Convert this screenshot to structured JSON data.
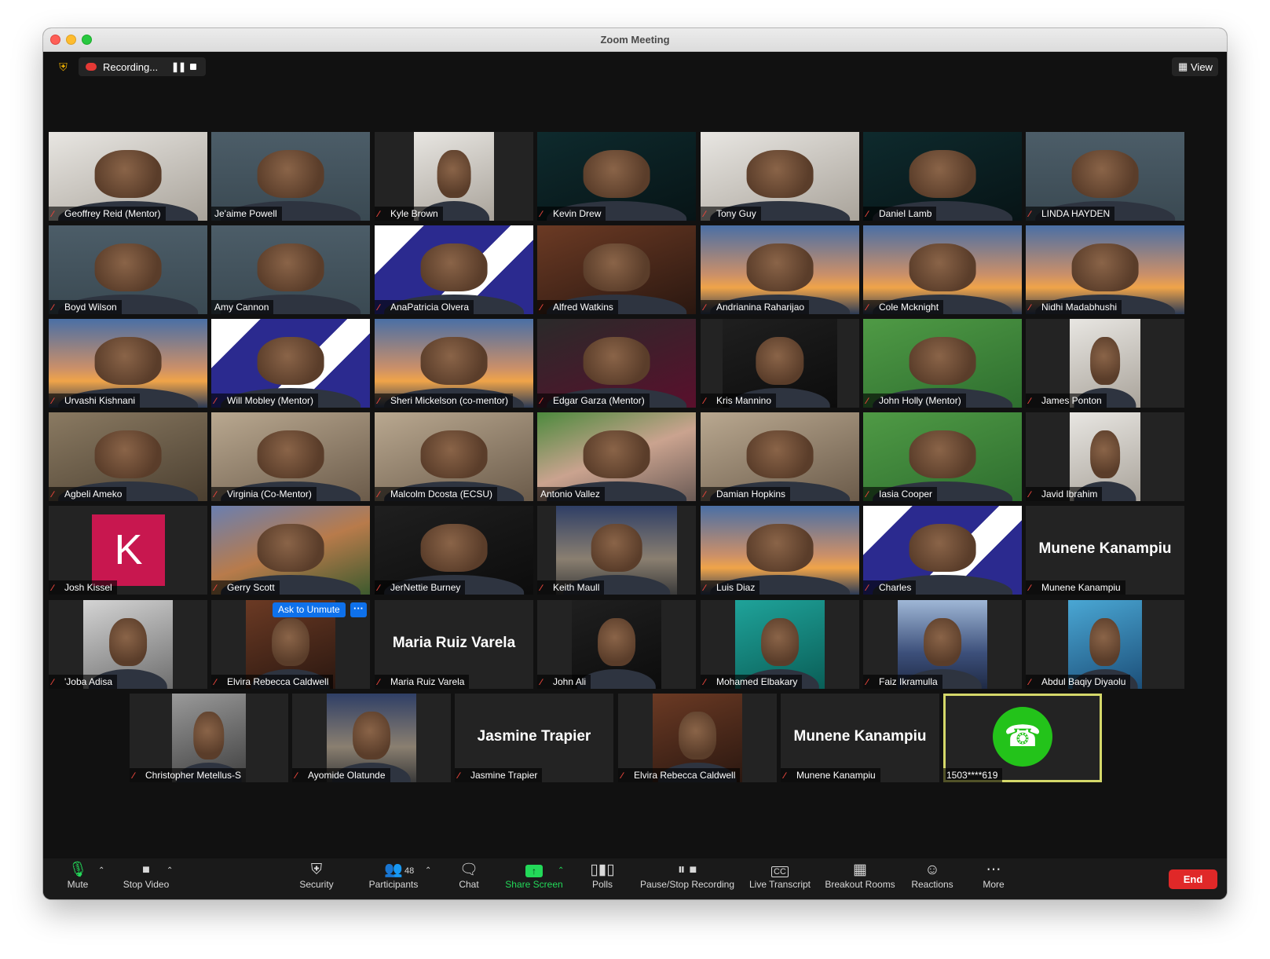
{
  "window": {
    "title": "Zoom Meeting"
  },
  "topbar": {
    "recording_label": "Recording...",
    "view_label": "View"
  },
  "participants": [
    {
      "name": "Geoffrey Reid (Mentor)",
      "muted": true
    },
    {
      "name": "Je'aime Powell",
      "muted": false
    },
    {
      "name": "Kyle Brown",
      "muted": true
    },
    {
      "name": "Kevin Drew",
      "muted": true
    },
    {
      "name": "Tony Guy",
      "muted": true
    },
    {
      "name": "Daniel Lamb",
      "muted": true
    },
    {
      "name": "LINDA HAYDEN",
      "muted": true
    },
    {
      "name": "Boyd Wilson",
      "muted": true
    },
    {
      "name": "Amy Cannon",
      "muted": false
    },
    {
      "name": "AnaPatricia Olvera",
      "muted": true
    },
    {
      "name": "Alfred Watkins",
      "muted": true
    },
    {
      "name": "Andrianina Raharijao",
      "muted": true
    },
    {
      "name": "Cole Mcknight",
      "muted": true
    },
    {
      "name": "Nidhi Madabhushi",
      "muted": true
    },
    {
      "name": "Urvashi Kishnani",
      "muted": true
    },
    {
      "name": "Will Mobley (Mentor)",
      "muted": true
    },
    {
      "name": "Sheri Mickelson (co-mentor)",
      "muted": true
    },
    {
      "name": "Edgar Garza (Mentor)",
      "muted": true
    },
    {
      "name": "Kris Mannino",
      "muted": true
    },
    {
      "name": "John Holly (Mentor)",
      "muted": true
    },
    {
      "name": "James Ponton",
      "muted": true
    },
    {
      "name": "Agbeli Ameko",
      "muted": true
    },
    {
      "name": "Virginia (Co-Mentor)",
      "muted": true
    },
    {
      "name": "Malcolm Dcosta (ECSU)",
      "muted": true
    },
    {
      "name": "Antonio Vallez",
      "muted": false
    },
    {
      "name": "Damian Hopkins",
      "muted": true
    },
    {
      "name": "Iasia Cooper",
      "muted": true
    },
    {
      "name": "Javid Ibrahim",
      "muted": true
    },
    {
      "name": "Josh Kissel",
      "muted": true,
      "avatar_letter": "K"
    },
    {
      "name": "Gerry Scott",
      "muted": true
    },
    {
      "name": "JerNettie Burney",
      "muted": true
    },
    {
      "name": "Keith Maull",
      "muted": true
    },
    {
      "name": "Luis Diaz",
      "muted": true
    },
    {
      "name": "Charles",
      "muted": true
    },
    {
      "name": "Munene Kanampiu",
      "muted": true,
      "display_name": "Munene Kanampiu"
    },
    {
      "name": "'Joba Adisa",
      "muted": true
    },
    {
      "name": "Elvira Rebecca Caldwell",
      "muted": true,
      "ask_to_unmute": "Ask to Unmute",
      "more": "···"
    },
    {
      "name": "Maria Ruiz Varela",
      "muted": true,
      "display_name": "Maria Ruiz Varela"
    },
    {
      "name": "John Ali",
      "muted": true
    },
    {
      "name": "Mohamed Elbakary",
      "muted": true
    },
    {
      "name": "Faiz Ikramulla",
      "muted": true
    },
    {
      "name": "Abdul Baqiy Diyaolu",
      "muted": true
    },
    {
      "name": "Christopher Metellus-S",
      "muted": true
    },
    {
      "name": "Ayomide Olatunde",
      "muted": true
    },
    {
      "name": "Jasmine Trapier",
      "muted": true,
      "display_name": "Jasmine Trapier"
    },
    {
      "name": "Elvira Rebecca Caldwell",
      "muted": true
    },
    {
      "name": "Munene Kanampiu",
      "muted": true,
      "display_name": "Munene Kanampiu"
    },
    {
      "name": "1503****619",
      "muted": false,
      "phone": true
    }
  ],
  "toolbar": {
    "mute": "Mute",
    "stop_video": "Stop Video",
    "security": "Security",
    "participants": "Participants",
    "participants_count": "48",
    "chat": "Chat",
    "share_screen": "Share Screen",
    "polls": "Polls",
    "pause_stop_recording": "Pause/Stop Recording",
    "live_transcript": "Live Transcript",
    "live_transcript_icon_text": "CC",
    "breakout_rooms": "Breakout Rooms",
    "reactions": "Reactions",
    "more": "More",
    "end": "End"
  },
  "colors": {
    "accent_blue": "#0e71eb",
    "end_red": "#e02828",
    "share_green": "#23d959",
    "active_speaker_border": "#d5d86a",
    "avatar_k": "#c8174f",
    "call_green": "#23c31a"
  }
}
